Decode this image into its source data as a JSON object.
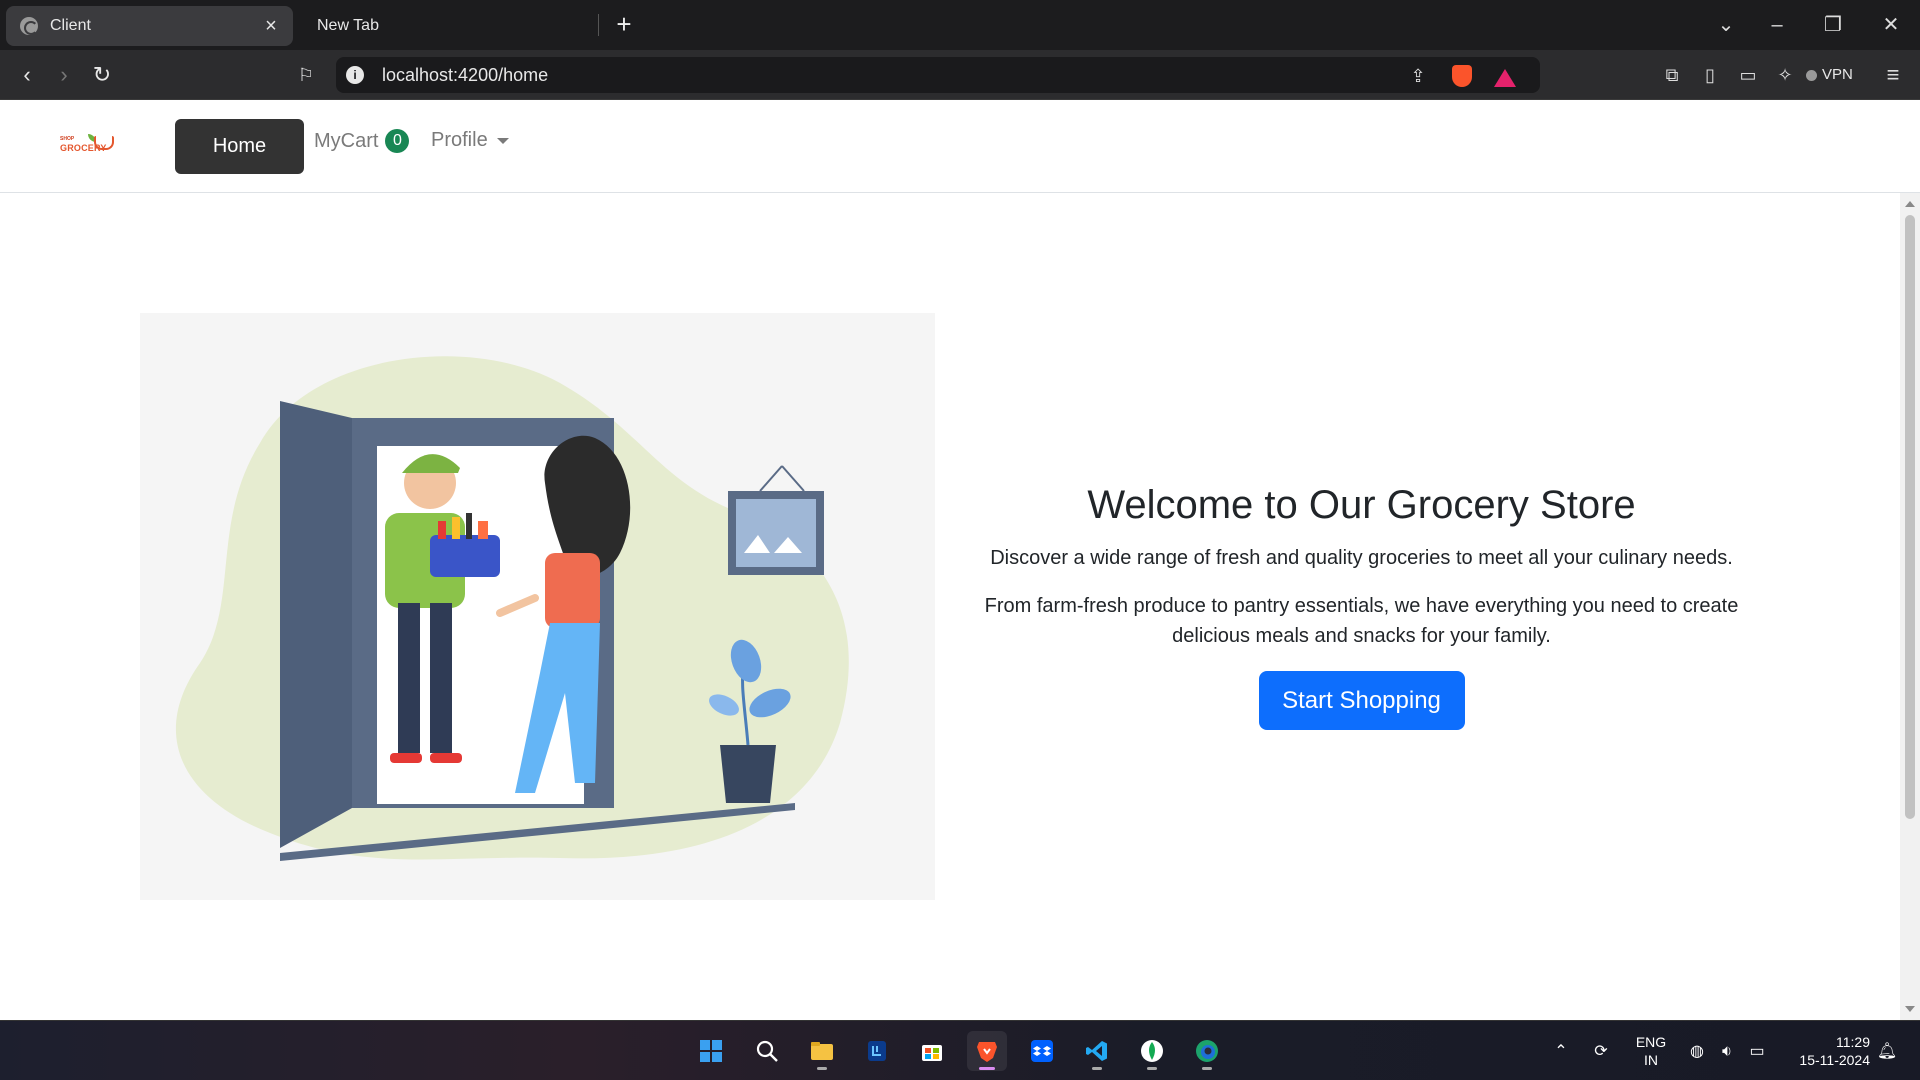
{
  "browser": {
    "tabs": [
      {
        "title": "Client",
        "active": true
      },
      {
        "title": "New Tab",
        "active": false
      }
    ],
    "url": "localhost:4200/home",
    "vpn_label": "VPN"
  },
  "nav": {
    "home_label": "Home",
    "mycart_label": "MyCart",
    "cart_count": "0",
    "profile_label": "Profile",
    "logo_top": "SHOP",
    "logo_word": "GROCERY"
  },
  "hero": {
    "title": "Welcome to Our Grocery Store",
    "lead": "Discover a wide range of fresh and quality groceries to meet all your culinary needs.",
    "body": "From farm-fresh produce to pantry essentials, we have everything you need to create delicious meals and snacks for your family.",
    "cta_label": "Start Shopping"
  },
  "taskbar": {
    "language_line1": "ENG",
    "language_line2": "IN",
    "time": "11:29",
    "date": "15-11-2024",
    "apps": [
      "start-icon",
      "search-icon",
      "file-explorer-icon",
      "app-icon",
      "store-icon",
      "brave-icon",
      "dropbox-icon",
      "vscode-icon",
      "mongodb-compass-icon",
      "edge-icon"
    ]
  },
  "colors": {
    "primary": "#0d6efd",
    "dark_button": "#333333",
    "badge": "#198754",
    "illustration_bg": "#f5f5f5"
  }
}
